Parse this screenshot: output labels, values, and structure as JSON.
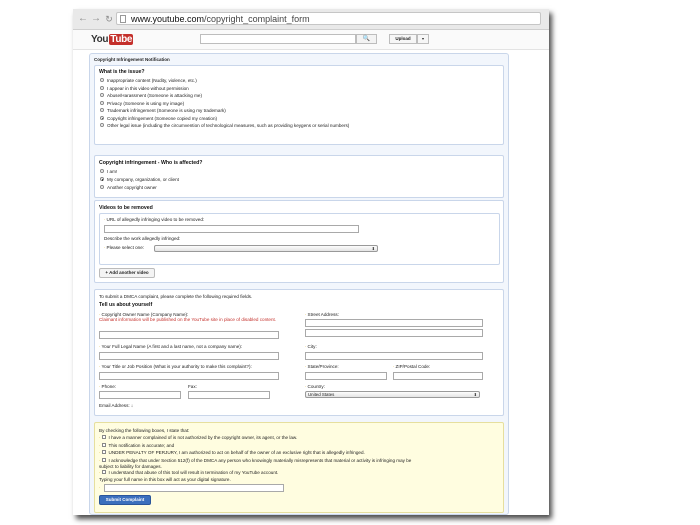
{
  "browser": {
    "url_domain": "www.youtube.com",
    "url_path": "/copyright_complaint_form",
    "back_icon": "back-arrow-icon",
    "forward_icon": "forward-arrow-icon",
    "reload_icon": "reload-icon"
  },
  "header": {
    "logo_you": "You",
    "logo_tube": "Tube",
    "search_placeholder": "",
    "search_button": "🔍",
    "upload_label": "Upload",
    "upload_dropdown": "▾"
  },
  "form": {
    "title": "Copyright Infringement Notification",
    "issue": {
      "heading": "What is the issue?",
      "options": [
        "Inappropriate content (Nudity, violence, etc.)",
        "I appear in this video without permission",
        "Abuse/Harassment (Someone is attacking me)",
        "Privacy (Someone is using my image)",
        "Trademark infringement (Someone is using my trademark)",
        "Copyright infringement (Someone copied my creation)",
        "Other legal issue (including the circumvention of technological measures, such as providing keygens or serial numbers)"
      ],
      "selected": 5
    },
    "affected": {
      "heading": "Copyright infringement - Who is affected?",
      "options": [
        "I am!",
        "My company, organization, or client",
        "Another copyright owner"
      ],
      "selected": 1
    },
    "videos": {
      "heading": "Videos to be removed",
      "url_label": "URL of allegedly infringing video to be removed:",
      "describe_label": "Describe the work allegedly infringed:",
      "select_label": "Please select one:",
      "select_value": "",
      "add_button": "+ Add another video"
    },
    "contact": {
      "intro": "To submit a DMCA complaint, please complete the following required fields.",
      "heading": "Tell us about yourself",
      "owner_label": "Copyright Owner Name (Company Name):",
      "owner_note": "Claimant information will be published on the YouTube site in place of disabled content.",
      "legal_name_label": "Your Full Legal Name (A first and a last name, not a company name):",
      "title_label": "Your Title or Job Position (What is your authority to make this complaint?):",
      "phone_label": "Phone:",
      "fax_label": "Fax:",
      "email_label": "Email Address: ↓",
      "street_label": "Street Address:",
      "city_label": "City:",
      "state_label": "State/Province:",
      "zip_label": "ZIP/Postal Code:",
      "country_label": "Country:",
      "country_value": "United States"
    },
    "statements": {
      "intro": "By checking the following boxes, I state that:",
      "items": [
        "I have a                                                        manner complained of is not authorized by the copyright owner, its agent, or the law.",
        "This notification is accurate; and",
        "UNDER PENALTY OF PERJURY, I am authorized to act on behalf of the owner of an exclusive right that is allegedly infringed.",
        "I acknowledge that under Section 512(f) of the DMCA any person who knowingly materially misrepresents that material or activity is infringing may be",
        "I understand that abuse of this tool will result in termination of my YouTube account."
      ],
      "liability_line": "subject to liability for damages.",
      "signature_label": "Typing your full name in this box will act as your digital signature.",
      "submit_label": "Submit Complaint"
    }
  }
}
